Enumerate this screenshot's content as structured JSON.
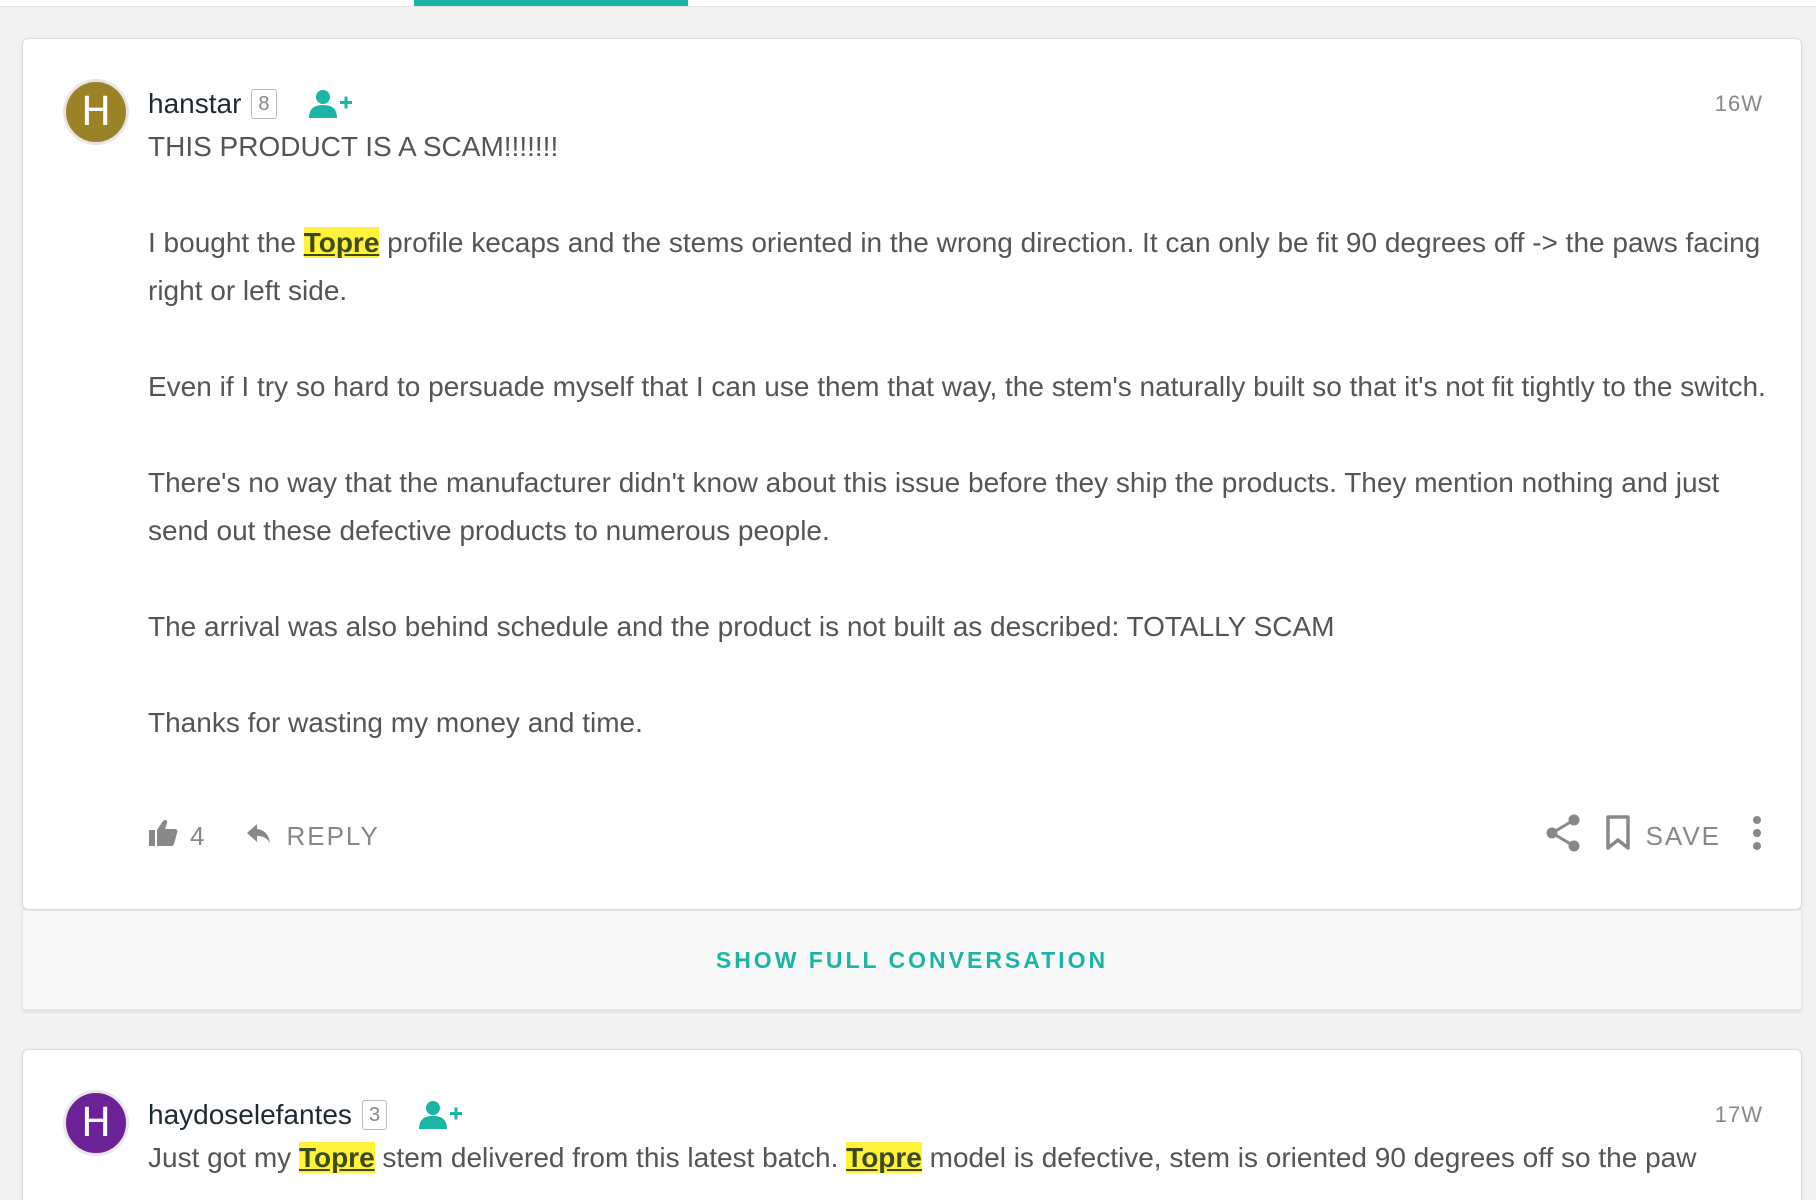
{
  "colors": {
    "accent": "#1bb5a5",
    "highlight": "#fff23a",
    "avatar_hanstar": "#9c8227",
    "avatar_haydoselefantes": "#6a2296"
  },
  "comments": [
    {
      "avatar_letter": "H",
      "username": "hanstar",
      "badge": "8",
      "timestamp": "16W",
      "icons": [
        "follow-user-icon",
        "thumbs-up-icon",
        "reply-arrow-icon",
        "share-icon",
        "bookmark-icon",
        "more-vertical-icon"
      ],
      "body": {
        "p1": "THIS PRODUCT IS A SCAM!!!!!!!",
        "p2_before": "I bought the ",
        "p2_highlight": "Topre",
        "p2_after": " profile kecaps and the stems oriented in the wrong direction. It can only be fit 90 degrees off -> the paws facing right or left side.",
        "p3": "Even if I try so hard to persuade myself that I can use them that way, the stem's naturally built so that it's not fit tightly to the switch.",
        "p4": "There's no way that the manufacturer didn't know about this issue before they ship the products. They mention nothing and just send out these defective products to numerous people.",
        "p5": "The arrival was also behind schedule and the product is not built as described: TOTALLY SCAM",
        "p6": "Thanks for wasting my money and time."
      },
      "likes": "4",
      "reply_label": "REPLY",
      "save_label": "SAVE"
    },
    {
      "avatar_letter": "H",
      "username": "haydoselefantes",
      "badge": "3",
      "timestamp": "17W",
      "body": {
        "part1": "Just got my ",
        "hl1": "Topre",
        "part2": " stem delivered from this latest batch. ",
        "hl2": "Topre",
        "part3": " model is defective, stem is oriented 90 degrees off so the paw"
      }
    }
  ],
  "show_full_conversation": "SHOW FULL CONVERSATION"
}
